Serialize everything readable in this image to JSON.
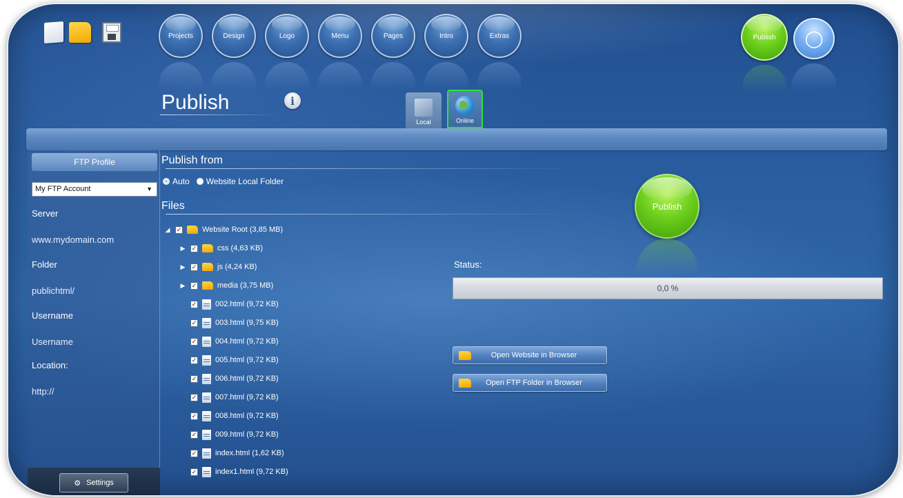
{
  "toolbar": {
    "new_icon": "new-document-icon",
    "open_icon": "folder-icon",
    "save_icon": "floppy-disk-icon"
  },
  "nav": {
    "items": [
      {
        "label": "Projects"
      },
      {
        "label": "Design"
      },
      {
        "label": "Logo"
      },
      {
        "label": "Menu"
      },
      {
        "label": "Pages"
      },
      {
        "label": "Intro"
      },
      {
        "label": "Extras"
      }
    ],
    "publish_label": "Publish",
    "tip_icon": "lightbulb-icon"
  },
  "page": {
    "title": "Publish",
    "info_icon": "info-icon"
  },
  "mode_tabs": {
    "local": "Local",
    "online": "Online",
    "selected": "Online"
  },
  "sidebar": {
    "title": "FTP Profile",
    "profile_selected": "My FTP Account",
    "server_label": "Server",
    "server_value": "www.mydomain.com",
    "folder_label": "Folder",
    "folder_value": "publichtml/",
    "username_label": "Username",
    "username_value": "Username",
    "location_label": "Location:",
    "location_value": "http://",
    "settings_label": "Settings"
  },
  "publish_from": {
    "heading": "Publish from",
    "options": [
      "Auto",
      "Website Local Folder"
    ],
    "selected": "Auto"
  },
  "files": {
    "heading": "Files",
    "root": "Website Root (3,85 MB)",
    "folders": [
      {
        "name": "css (4,63 KB)"
      },
      {
        "name": "js (4,24 KB)"
      },
      {
        "name": "media (3,75 MB)"
      }
    ],
    "items": [
      {
        "name": "002.html (9,72 KB)"
      },
      {
        "name": "003.html (9,75 KB)"
      },
      {
        "name": "004.html (9,72 KB)"
      },
      {
        "name": "005.html (9,72 KB)"
      },
      {
        "name": "006.html (9,72 KB)"
      },
      {
        "name": "007.html (9,72 KB)"
      },
      {
        "name": "008.html (9,72 KB)"
      },
      {
        "name": "009.html (9,72 KB)"
      },
      {
        "name": "index.html (1,62 KB)"
      },
      {
        "name": "index1.html (9,72 KB)"
      }
    ]
  },
  "status": {
    "label": "Status:",
    "progress_text": "0,0 %",
    "progress_fraction": 0.0
  },
  "main_publish_label": "Publish",
  "actions": {
    "open_website": "Open Website in Browser",
    "open_ftp": "Open FTP Folder in Browser"
  },
  "colors": {
    "accent_green": "#6ccf1c",
    "background_blue": "#2e66a8",
    "folder_yellow": "#f1a600"
  }
}
